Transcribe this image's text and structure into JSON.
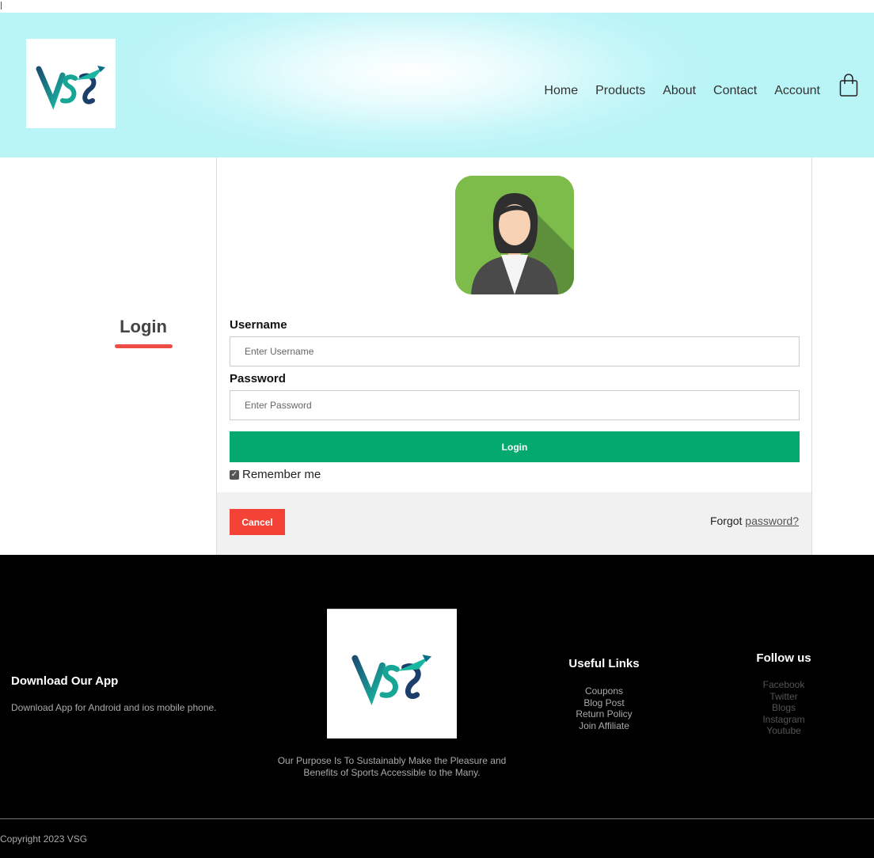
{
  "header": {
    "logo_alt": "VSG",
    "nav": [
      "Home",
      "Products",
      "About",
      "Contact",
      "Account"
    ],
    "cart_icon": "shopping-bag-icon"
  },
  "login": {
    "heading": "Login",
    "avatar_icon": "user-avatar-icon",
    "username_label": "Username",
    "username_placeholder": "Enter Username",
    "password_label": "Password",
    "password_placeholder": "Enter Password",
    "submit_label": "Login",
    "remember_label": "Remember me",
    "remember_checked": true,
    "cancel_label": "Cancel",
    "forgot_prefix": "Forgot",
    "forgot_link": "password?"
  },
  "footer": {
    "download_title": "Download Our App",
    "download_text": "Download App for Android and ios mobile phone.",
    "purpose": "Our Purpose Is To Sustainably Make the Pleasure and Benefits of Sports Accessible to the Many.",
    "useful_title": "Useful Links",
    "useful_links": [
      "Coupons",
      "Blog Post",
      "Return Policy",
      "Join Affiliate"
    ],
    "follow_title": "Follow us",
    "follow_links": [
      "Facebook",
      "Twitter",
      "Blogs",
      "Instagram",
      "Youtube"
    ],
    "copyright": "Copyright 2023 VSG"
  },
  "colors": {
    "header_bg": "#b9f4f6",
    "login_green": "#04aa6d",
    "cancel_red": "#f44336",
    "underline_red": "#ef4d44",
    "footer_bg": "#000000"
  }
}
